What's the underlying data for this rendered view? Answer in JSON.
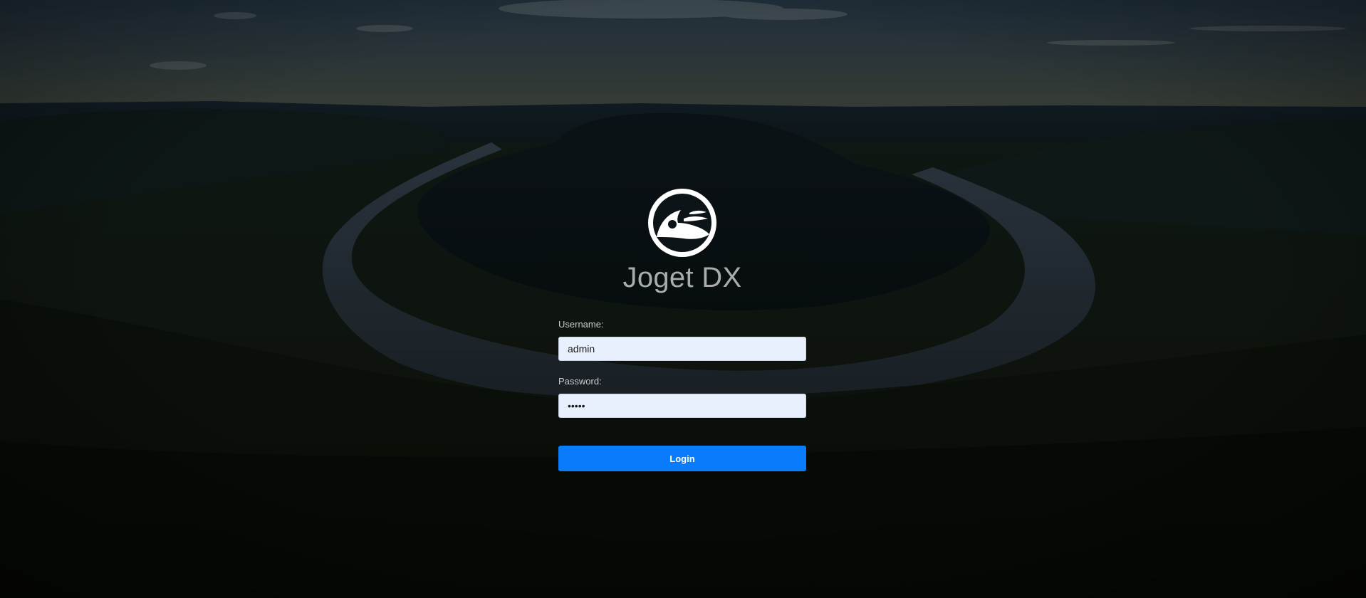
{
  "brand": {
    "name": "Joget DX",
    "logo_icon": "joget-logo-icon"
  },
  "form": {
    "username_label": "Username:",
    "username_value": "admin",
    "password_label": "Password:",
    "password_value": "•••••",
    "login_label": "Login"
  },
  "colors": {
    "button": "#0a7bfb",
    "input_bg": "#e8f0fe",
    "brand_text": "#a9acae",
    "label_text": "#c8cbcd"
  }
}
